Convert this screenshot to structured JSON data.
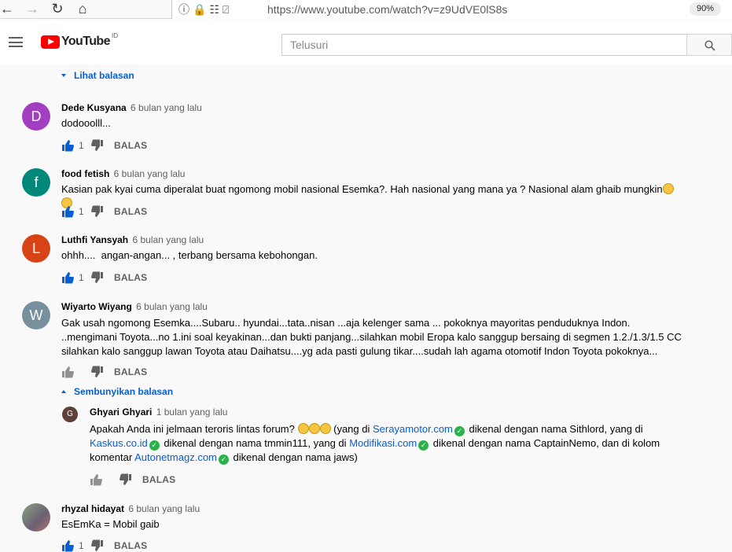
{
  "browser": {
    "url": "https://www.youtube.com/watch?v=z9UdVE0lS8s",
    "zoom": "90%"
  },
  "header": {
    "logo_text": "YouTube",
    "logo_region": "ID",
    "search_placeholder": "Telusuri"
  },
  "view_replies_label": "Lihat balasan",
  "hide_replies_label": "Sembunyikan balasan",
  "reply_label": "BALAS",
  "comments": [
    {
      "avatar_letter": "D",
      "avatar_color": "#a23fc0",
      "author": "Dede Kusyana",
      "time": "6 bulan yang lalu",
      "text": "dodooolll...",
      "likes": "1"
    },
    {
      "avatar_letter": "f",
      "avatar_color": "#00897b",
      "author": "food fetish",
      "time": "6 bulan yang lalu",
      "text": "Kasian pak kyai cuma diperalat buat ngomong mobil nasional Esemka?. Hah nasional yang mana ya ? Nasional alam ghaib mungkin",
      "likes": "1"
    },
    {
      "avatar_letter": "L",
      "avatar_color": "#d84315",
      "author": "Luthfi Yansyah",
      "time": "6 bulan yang lalu",
      "text": "ohhh....  angan-angan... , terbang bersama kebohongan.",
      "likes": "1"
    },
    {
      "avatar_letter": "W",
      "avatar_color": "#78909c",
      "author": "Wiyarto Wiyang",
      "time": "6 bulan yang lalu",
      "text": "Gak usah ngomong Esemka....Subaru.. hyundai...tata..nisan ...aja kelenger sama ... pokoknya mayoritas penduduknya Indon.  ..mengimani Toyota...no 1.ini soal keyakinan...dan bukti panjang...silahkan mobil Eropa kalo sanggup bersaing di segmen 1.2./1.3/1.5 CC silahkan kalo sanggup lawan Toyota atau Daihatsu....yg ada pasti gulung tikar....sudah lah agama otomotif Indon Toyota pokoknya...",
      "likes": ""
    },
    {
      "avatar_letter": "",
      "avatar_color": "#6d7b6a",
      "author": "rhyzal hidayat",
      "time": "6 bulan yang lalu",
      "text": "EsEmKa = Mobil gaib",
      "likes": "1"
    }
  ],
  "reply": {
    "avatar_letter": "G",
    "avatar_color": "#5d4037",
    "author": "Ghyari Ghyari",
    "time": "1 bulan yang lalu",
    "text_1": "Apakah Anda ini jelmaan teroris lintas forum?",
    "text_2": "(yang di",
    "link_1": "Serayamotor.com",
    "text_3": "dikenal dengan nama Sithlord, yang di",
    "link_2": "Kaskus.co.id",
    "text_4": "dikenal dengan nama tmmin111, yang di",
    "link_3": "Modifikasi.com",
    "text_5": "dikenal dengan nama CaptainNemo, dan di kolom komentar",
    "link_4": "Autonetmagz.com",
    "text_6": "dikenal dengan nama jaws)",
    "likes": ""
  }
}
